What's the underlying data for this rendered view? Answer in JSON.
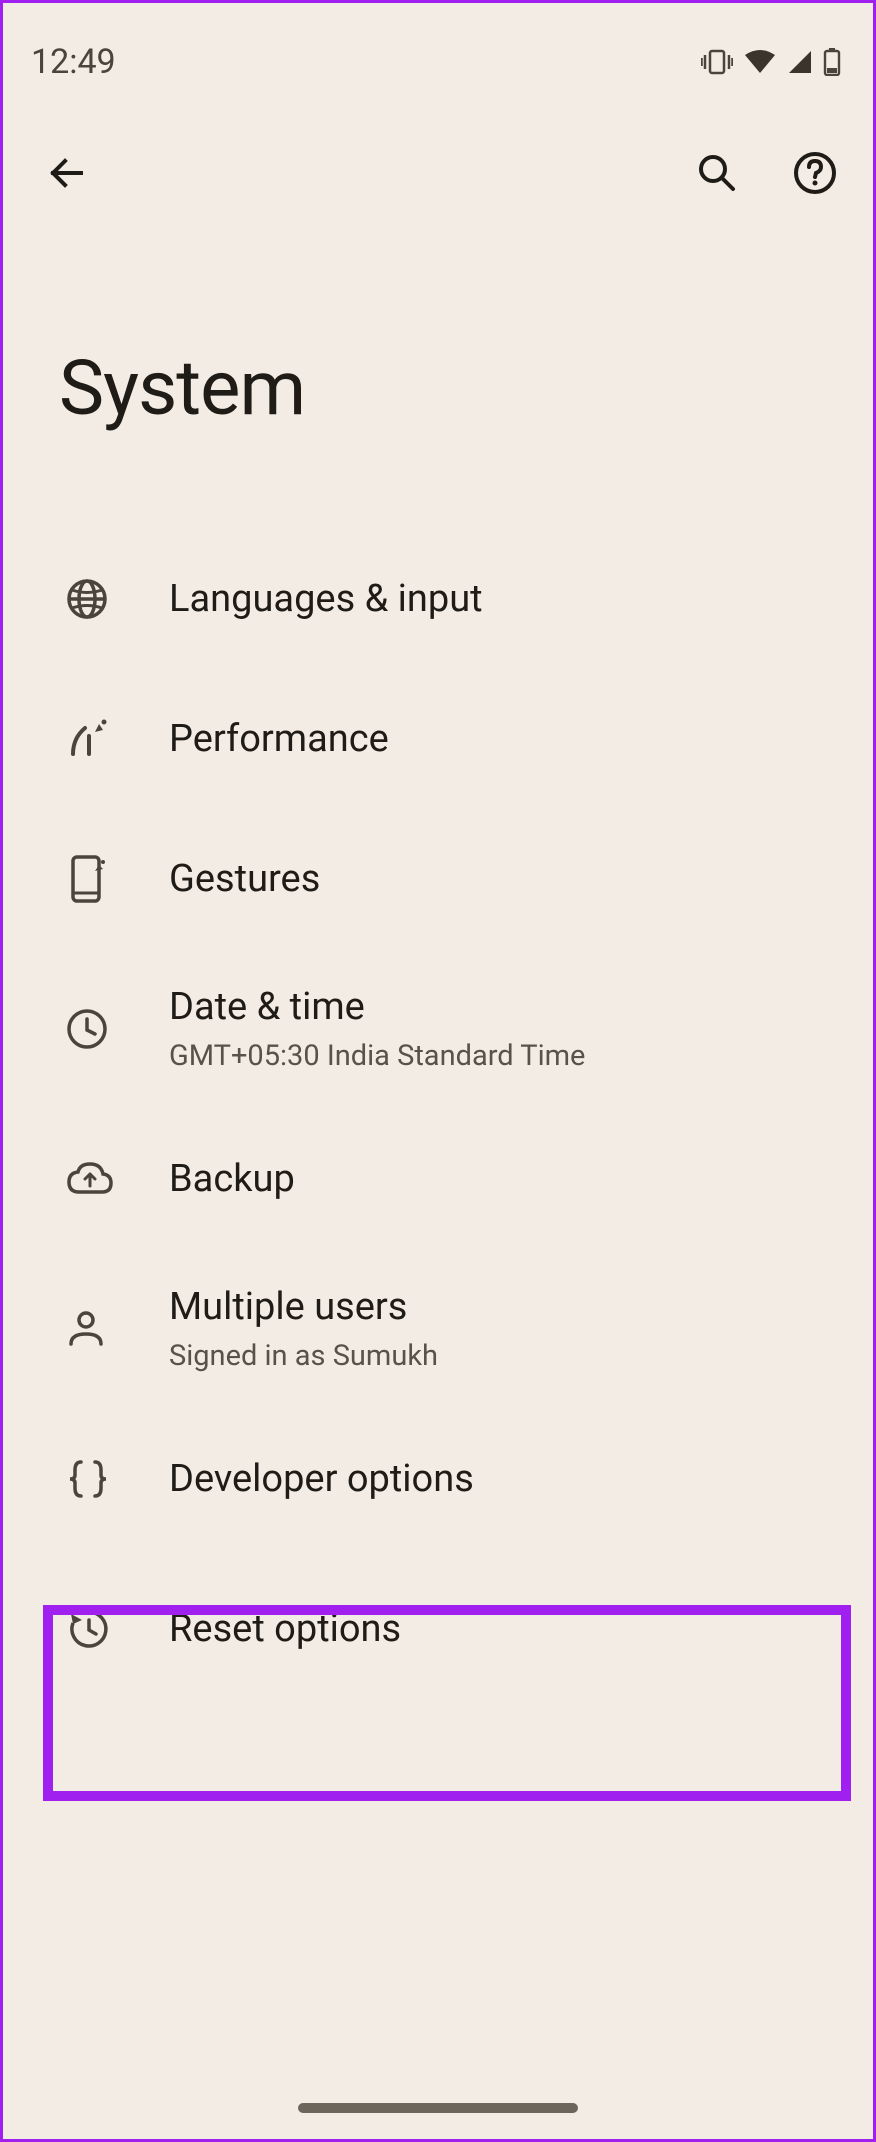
{
  "status": {
    "time": "12:49"
  },
  "header": {
    "title": "System"
  },
  "items": [
    {
      "icon": "globe",
      "title": "Languages & input",
      "subtitle": ""
    },
    {
      "icon": "performance",
      "title": "Performance",
      "subtitle": ""
    },
    {
      "icon": "gestures",
      "title": "Gestures",
      "subtitle": ""
    },
    {
      "icon": "clock",
      "title": "Date & time",
      "subtitle": "GMT+05:30 India Standard Time"
    },
    {
      "icon": "backup",
      "title": "Backup",
      "subtitle": ""
    },
    {
      "icon": "person",
      "title": "Multiple users",
      "subtitle": "Signed in as Sumukh"
    },
    {
      "icon": "braces",
      "title": "Developer options",
      "subtitle": ""
    },
    {
      "icon": "reset",
      "title": "Reset options",
      "subtitle": ""
    }
  ]
}
